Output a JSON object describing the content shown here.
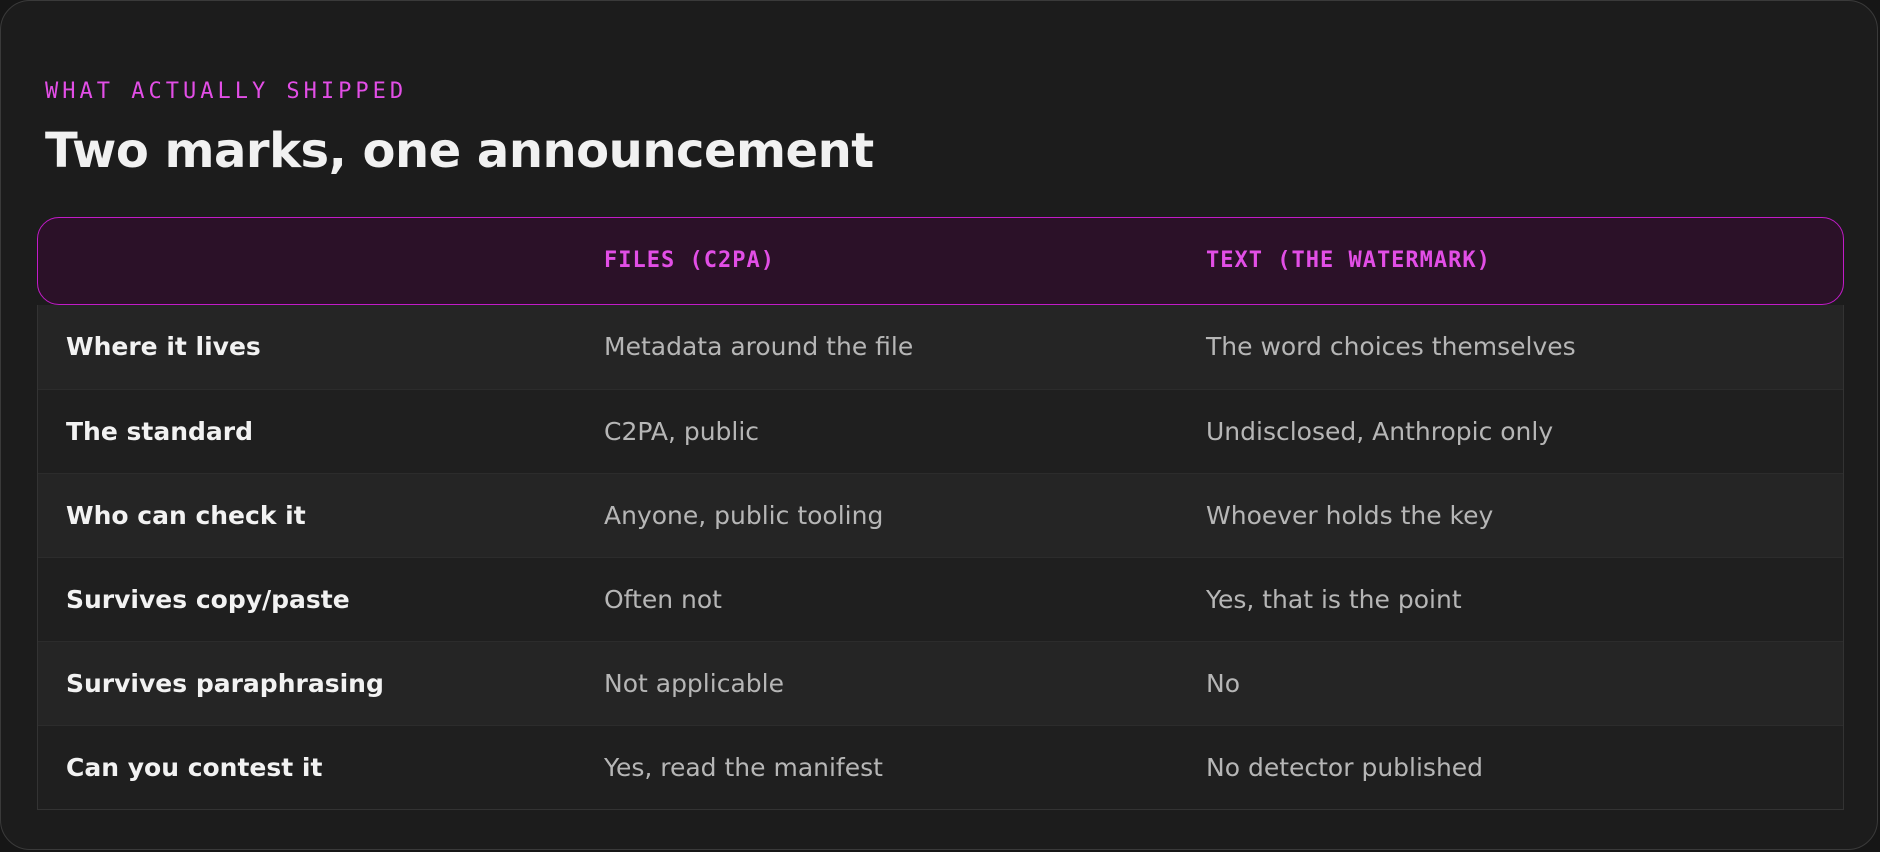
{
  "section": {
    "eyebrow": "WHAT ACTUALLY SHIPPED",
    "title": "Two marks, one announcement"
  },
  "table": {
    "headers": [
      "",
      "FILES (C2PA)",
      "TEXT (THE WATERMARK)"
    ],
    "rows": [
      {
        "label": "Where it lives",
        "files": "Metadata around the file",
        "text": "The word choices themselves"
      },
      {
        "label": "The standard",
        "files": "C2PA, public",
        "text": "Undisclosed, Anthropic only"
      },
      {
        "label": "Who can check it",
        "files": "Anyone, public tooling",
        "text": "Whoever holds the key"
      },
      {
        "label": "Survives copy/paste",
        "files": "Often not",
        "text": "Yes, that is the point"
      },
      {
        "label": "Survives paraphrasing",
        "files": "Not applicable",
        "text": "No"
      },
      {
        "label": "Can you contest it",
        "files": "Yes, read the manifest",
        "text": "No detector published"
      }
    ]
  },
  "colors": {
    "accent": "#e24ee6",
    "header_border": "#c21bc8",
    "header_bg": "#2b1128",
    "background": "#1c1c1c"
  }
}
